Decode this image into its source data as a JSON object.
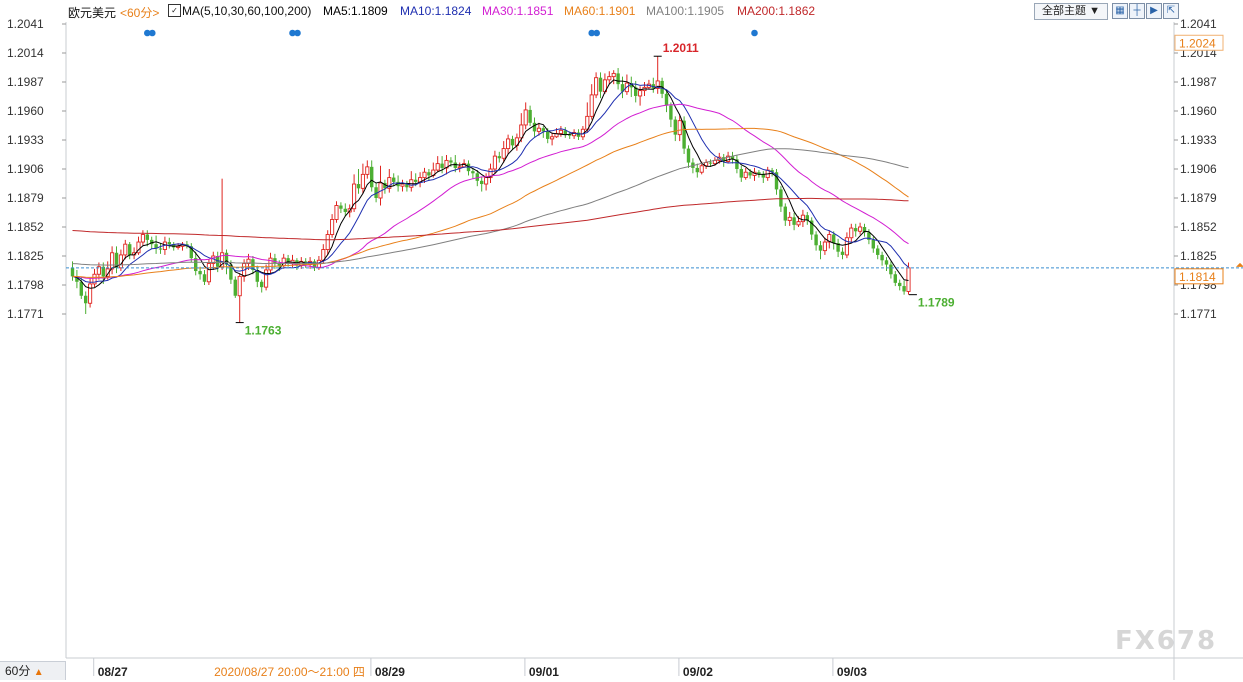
{
  "header": {
    "symbol": "欧元美元",
    "period_tag": "<60分>",
    "ma_title": "MA(5,10,30,60,100,200)",
    "ma_values": [
      {
        "text": "MA5:1.1809",
        "color": "#000000"
      },
      {
        "text": "MA10:1.1824",
        "color": "#1f2fb0"
      },
      {
        "text": "MA30:1.1851",
        "color": "#d21ed2"
      },
      {
        "text": "MA60:1.1901",
        "color": "#e8801a"
      },
      {
        "text": "MA100:1.1905",
        "color": "#808080"
      },
      {
        "text": "MA200:1.1862",
        "color": "#c0282a"
      }
    ],
    "theme_select": "全部主题",
    "tool_icons": [
      "grid-icon",
      "crosshair-icon",
      "play-icon",
      "export-icon"
    ]
  },
  "footer": {
    "period_button": "60分",
    "watermark": "FX678"
  },
  "chart_data": {
    "type": "candlestick",
    "title": "欧元美元",
    "interval": "60分",
    "y_ticks": [
      "1.2041",
      "1.2014",
      "1.1987",
      "1.1960",
      "1.1933",
      "1.1906",
      "1.1879",
      "1.1852",
      "1.1825",
      "1.1798",
      "1.1771"
    ],
    "ylim": [
      1.175,
      1.2041
    ],
    "x_labels": [
      {
        "label": "08/27",
        "bar": 8
      },
      {
        "label": "2020/08/27 20:00～21:00 四",
        "bar": 34,
        "highlight": true
      },
      {
        "label": "08/29",
        "bar": 71
      },
      {
        "label": "09/01",
        "bar": 106
      },
      {
        "label": "09/02",
        "bar": 141
      },
      {
        "label": "09/03",
        "bar": 176
      }
    ],
    "current_price": "1.1814",
    "last_price_value": 1.1814,
    "ma200_tag": "1.2024",
    "annotations": [
      {
        "text": "1.2011",
        "bar": 133,
        "price": 1.2011,
        "type": "high"
      },
      {
        "text": "1.1763",
        "bar": 38,
        "price": 1.1763,
        "type": "low"
      },
      {
        "text": "1.1789",
        "bar": 191,
        "price": 1.1789,
        "type": "low"
      }
    ],
    "event_dots": [
      17,
      50,
      118,
      155
    ],
    "candles": [
      [
        1.1814,
        1.1806,
        1.182,
        1.1802
      ],
      [
        1.1806,
        1.1801,
        1.1812,
        1.1795
      ],
      [
        1.1801,
        1.1788,
        1.1805,
        1.1785
      ],
      [
        1.1788,
        1.1781,
        1.1792,
        1.1771
      ],
      [
        1.1781,
        1.1799,
        1.1804,
        1.1777
      ],
      [
        1.1799,
        1.1808,
        1.1813,
        1.1796
      ],
      [
        1.1808,
        1.1815,
        1.1819,
        1.1803
      ],
      [
        1.1815,
        1.1806,
        1.1819,
        1.1799
      ],
      [
        1.1806,
        1.1813,
        1.182,
        1.1803
      ],
      [
        1.1813,
        1.1828,
        1.1834,
        1.1808
      ],
      [
        1.1828,
        1.1814,
        1.1834,
        1.1809
      ],
      [
        1.1814,
        1.1826,
        1.1831,
        1.1811
      ],
      [
        1.1826,
        1.1836,
        1.184,
        1.1822
      ],
      [
        1.1836,
        1.1826,
        1.1838,
        1.1822
      ],
      [
        1.1826,
        1.1828,
        1.1833,
        1.1822
      ],
      [
        1.1828,
        1.1838,
        1.1843,
        1.1826
      ],
      [
        1.1838,
        1.1845,
        1.1849,
        1.1835
      ],
      [
        1.1845,
        1.184,
        1.1849,
        1.1834
      ],
      [
        1.184,
        1.1836,
        1.1843,
        1.1832
      ],
      [
        1.1836,
        1.1832,
        1.1844,
        1.1827
      ],
      [
        1.1832,
        1.1831,
        1.1837,
        1.1827
      ],
      [
        1.1831,
        1.1838,
        1.1843,
        1.1826
      ],
      [
        1.1838,
        1.1836,
        1.1842,
        1.1832
      ],
      [
        1.1836,
        1.1833,
        1.1838,
        1.183
      ],
      [
        1.1833,
        1.1834,
        1.1837,
        1.1831
      ],
      [
        1.1834,
        1.1836,
        1.1838,
        1.183
      ],
      [
        1.1836,
        1.1834,
        1.1839,
        1.1832
      ],
      [
        1.1834,
        1.1823,
        1.1837,
        1.1819
      ],
      [
        1.1823,
        1.1811,
        1.1829,
        1.1807
      ],
      [
        1.1811,
        1.1808,
        1.1815,
        1.1803
      ],
      [
        1.1808,
        1.1801,
        1.1812,
        1.1798
      ],
      [
        1.1801,
        1.1818,
        1.1822,
        1.1798
      ],
      [
        1.1818,
        1.1825,
        1.1829,
        1.1812
      ],
      [
        1.1825,
        1.1815,
        1.1829,
        1.181
      ],
      [
        1.1815,
        1.1828,
        1.1897,
        1.1812
      ],
      [
        1.1828,
        1.1817,
        1.1831,
        1.1808
      ],
      [
        1.1817,
        1.1803,
        1.1821,
        1.1799
      ],
      [
        1.1803,
        1.1788,
        1.1806,
        1.1786
      ],
      [
        1.1788,
        1.1806,
        1.1809,
        1.1763
      ],
      [
        1.1806,
        1.1818,
        1.1822,
        1.1801
      ],
      [
        1.1818,
        1.1822,
        1.1827,
        1.1812
      ],
      [
        1.1822,
        1.1812,
        1.1825,
        1.1808
      ],
      [
        1.1812,
        1.1801,
        1.1816,
        1.1796
      ],
      [
        1.1801,
        1.1796,
        1.1803,
        1.1791
      ],
      [
        1.1796,
        1.1812,
        1.1817,
        1.1793
      ],
      [
        1.1812,
        1.1823,
        1.1828,
        1.1809
      ],
      [
        1.1823,
        1.1818,
        1.1827,
        1.1813
      ],
      [
        1.1818,
        1.1816,
        1.1821,
        1.1811
      ],
      [
        1.1816,
        1.1823,
        1.1827,
        1.1813
      ],
      [
        1.1823,
        1.1818,
        1.1826,
        1.1815
      ],
      [
        1.1818,
        1.1821,
        1.1826,
        1.1814
      ],
      [
        1.1821,
        1.1816,
        1.1823,
        1.1812
      ],
      [
        1.1816,
        1.182,
        1.1824,
        1.1813
      ],
      [
        1.182,
        1.1817,
        1.1823,
        1.1814
      ],
      [
        1.1817,
        1.182,
        1.1824,
        1.1813
      ],
      [
        1.182,
        1.1814,
        1.1822,
        1.1811
      ],
      [
        1.1814,
        1.1821,
        1.1825,
        1.1812
      ],
      [
        1.1821,
        1.1831,
        1.1836,
        1.1818
      ],
      [
        1.1831,
        1.1845,
        1.1849,
        1.1826
      ],
      [
        1.1845,
        1.1859,
        1.1864,
        1.1842
      ],
      [
        1.1859,
        1.1872,
        1.1876,
        1.1856
      ],
      [
        1.1872,
        1.1869,
        1.1875,
        1.1865
      ],
      [
        1.1869,
        1.1866,
        1.1874,
        1.1862
      ],
      [
        1.1866,
        1.1869,
        1.1873,
        1.1861
      ],
      [
        1.1869,
        1.1892,
        1.1901,
        1.1866
      ],
      [
        1.1892,
        1.1888,
        1.1906,
        1.1883
      ],
      [
        1.1888,
        1.1901,
        1.1911,
        1.1883
      ],
      [
        1.1901,
        1.1908,
        1.1914,
        1.1897
      ],
      [
        1.1908,
        1.1889,
        1.1914,
        1.1885
      ],
      [
        1.1889,
        1.1879,
        1.1893,
        1.1875
      ],
      [
        1.1879,
        1.1893,
        1.1909,
        1.1872
      ],
      [
        1.1893,
        1.1888,
        1.1896,
        1.1883
      ],
      [
        1.1888,
        1.1898,
        1.1906,
        1.1884
      ],
      [
        1.1898,
        1.1894,
        1.1902,
        1.189
      ],
      [
        1.1894,
        1.189,
        1.19,
        1.1885
      ],
      [
        1.189,
        1.1892,
        1.1896,
        1.1885
      ],
      [
        1.1892,
        1.1889,
        1.1895,
        1.1885
      ],
      [
        1.1889,
        1.1896,
        1.1904,
        1.1885
      ],
      [
        1.1896,
        1.1894,
        1.1902,
        1.189
      ],
      [
        1.1894,
        1.1898,
        1.1903,
        1.1889
      ],
      [
        1.1898,
        1.1903,
        1.1907,
        1.1893
      ],
      [
        1.1903,
        1.19,
        1.1906,
        1.1895
      ],
      [
        1.19,
        1.1905,
        1.1912,
        1.1898
      ],
      [
        1.1905,
        1.1911,
        1.1918,
        1.1903
      ],
      [
        1.1911,
        1.1907,
        1.1918,
        1.1902
      ],
      [
        1.1907,
        1.1914,
        1.1919,
        1.1901
      ],
      [
        1.1914,
        1.1912,
        1.1917,
        1.1908
      ],
      [
        1.1912,
        1.1907,
        1.1919,
        1.1903
      ],
      [
        1.1907,
        1.1908,
        1.1912,
        1.1903
      ],
      [
        1.1908,
        1.1911,
        1.1915,
        1.1907
      ],
      [
        1.1911,
        1.1904,
        1.1914,
        1.19
      ],
      [
        1.1904,
        1.1902,
        1.1907,
        1.1897
      ],
      [
        1.1902,
        1.1895,
        1.1905,
        1.189
      ],
      [
        1.1895,
        1.1892,
        1.1899,
        1.1885
      ],
      [
        1.1892,
        1.1898,
        1.1902,
        1.1886
      ],
      [
        1.1898,
        1.1906,
        1.1911,
        1.1893
      ],
      [
        1.1906,
        1.1918,
        1.1923,
        1.1902
      ],
      [
        1.1918,
        1.1916,
        1.1922,
        1.1912
      ],
      [
        1.1916,
        1.1925,
        1.1932,
        1.1912
      ],
      [
        1.1925,
        1.1934,
        1.1938,
        1.192
      ],
      [
        1.1934,
        1.1928,
        1.1937,
        1.1924
      ],
      [
        1.1928,
        1.1935,
        1.1939,
        1.1923
      ],
      [
        1.1935,
        1.1947,
        1.1958,
        1.1931
      ],
      [
        1.1947,
        1.1961,
        1.1968,
        1.1943
      ],
      [
        1.1961,
        1.1949,
        1.1965,
        1.1946
      ],
      [
        1.1949,
        1.1941,
        1.1954,
        1.1936
      ],
      [
        1.1941,
        1.1944,
        1.1949,
        1.1937
      ],
      [
        1.1944,
        1.1941,
        1.1946,
        1.1935
      ],
      [
        1.1941,
        1.1934,
        1.1944,
        1.193
      ],
      [
        1.1934,
        1.1936,
        1.194,
        1.1928
      ],
      [
        1.1936,
        1.1939,
        1.1944,
        1.1935
      ],
      [
        1.1939,
        1.1942,
        1.1946,
        1.1936
      ],
      [
        1.1942,
        1.1938,
        1.1945,
        1.1935
      ],
      [
        1.1938,
        1.1937,
        1.1941,
        1.1934
      ],
      [
        1.1937,
        1.194,
        1.1943,
        1.1934
      ],
      [
        1.194,
        1.1936,
        1.1943,
        1.1933
      ],
      [
        1.1936,
        1.1943,
        1.1946,
        1.1933
      ],
      [
        1.1943,
        1.1955,
        1.1968,
        1.194
      ],
      [
        1.1955,
        1.1975,
        1.1985,
        1.1952
      ],
      [
        1.1975,
        1.1991,
        1.1996,
        1.1972
      ],
      [
        1.1991,
        1.1978,
        1.1996,
        1.1972
      ],
      [
        1.1978,
        1.1989,
        1.1995,
        1.1976
      ],
      [
        1.1989,
        1.1992,
        1.1997,
        1.1985
      ],
      [
        1.1992,
        1.1995,
        1.1998,
        1.1985
      ],
      [
        1.1995,
        1.1985,
        1.2,
        1.198
      ],
      [
        1.1985,
        1.1978,
        1.1992,
        1.1972
      ],
      [
        1.1978,
        1.1986,
        1.1994,
        1.1975
      ],
      [
        1.1986,
        1.1982,
        1.1992,
        1.1973
      ],
      [
        1.1982,
        1.1974,
        1.1988,
        1.1968
      ],
      [
        1.1974,
        1.1979,
        1.1983,
        1.1965
      ],
      [
        1.1979,
        1.1982,
        1.1987,
        1.1974
      ],
      [
        1.1982,
        1.1985,
        1.1989,
        1.198
      ],
      [
        1.1985,
        1.1981,
        1.1991,
        1.1977
      ],
      [
        1.1981,
        1.1988,
        1.2011,
        1.1976
      ],
      [
        1.1988,
        1.1976,
        1.1991,
        1.1972
      ],
      [
        1.1976,
        1.1965,
        1.1979,
        1.1959
      ],
      [
        1.1965,
        1.1952,
        1.1968,
        1.1945
      ],
      [
        1.1952,
        1.1938,
        1.1955,
        1.1932
      ],
      [
        1.1938,
        1.1951,
        1.1956,
        1.1932
      ],
      [
        1.1951,
        1.1925,
        1.1955,
        1.192
      ],
      [
        1.1925,
        1.1912,
        1.1928,
        1.1907
      ],
      [
        1.1912,
        1.1907,
        1.1916,
        1.1902
      ],
      [
        1.1907,
        1.1903,
        1.1911,
        1.1898
      ],
      [
        1.1903,
        1.1909,
        1.1913,
        1.1901
      ],
      [
        1.1909,
        1.1912,
        1.1915,
        1.1906
      ],
      [
        1.1912,
        1.1911,
        1.1915,
        1.1908
      ],
      [
        1.1911,
        1.1914,
        1.1917,
        1.1909
      ],
      [
        1.1914,
        1.1917,
        1.1921,
        1.1911
      ],
      [
        1.1917,
        1.1913,
        1.192,
        1.1908
      ],
      [
        1.1913,
        1.1918,
        1.1922,
        1.1912
      ],
      [
        1.1918,
        1.1915,
        1.1922,
        1.1911
      ],
      [
        1.1915,
        1.1906,
        1.1919,
        1.1902
      ],
      [
        1.1906,
        1.1898,
        1.1909,
        1.1894
      ],
      [
        1.1898,
        1.1903,
        1.1907,
        1.1896
      ],
      [
        1.1903,
        1.19,
        1.1906,
        1.1897
      ],
      [
        1.19,
        1.1903,
        1.1907,
        1.1895
      ],
      [
        1.1903,
        1.1901,
        1.1905,
        1.1898
      ],
      [
        1.1901,
        1.1898,
        1.1904,
        1.1893
      ],
      [
        1.1898,
        1.1905,
        1.1908,
        1.1895
      ],
      [
        1.1905,
        1.1903,
        1.1907,
        1.1899
      ],
      [
        1.1903,
        1.1887,
        1.1906,
        1.1882
      ],
      [
        1.1887,
        1.1871,
        1.189,
        1.1866
      ],
      [
        1.1871,
        1.1858,
        1.1874,
        1.1853
      ],
      [
        1.1858,
        1.1861,
        1.1866,
        1.1853
      ],
      [
        1.1861,
        1.1854,
        1.1865,
        1.1849
      ],
      [
        1.1854,
        1.1857,
        1.1862,
        1.1852
      ],
      [
        1.1857,
        1.1863,
        1.1868,
        1.1852
      ],
      [
        1.1863,
        1.1858,
        1.1866,
        1.1854
      ],
      [
        1.1858,
        1.1845,
        1.1861,
        1.184
      ],
      [
        1.1845,
        1.1835,
        1.1848,
        1.183
      ],
      [
        1.1835,
        1.183,
        1.1839,
        1.1822
      ],
      [
        1.183,
        1.1838,
        1.1842,
        1.1826
      ],
      [
        1.1838,
        1.1845,
        1.1849,
        1.1832
      ],
      [
        1.1845,
        1.1837,
        1.1848,
        1.1831
      ],
      [
        1.1837,
        1.1829,
        1.1841,
        1.1824
      ],
      [
        1.1829,
        1.1826,
        1.1833,
        1.1822
      ],
      [
        1.1826,
        1.1842,
        1.1847,
        1.1823
      ],
      [
        1.1842,
        1.1851,
        1.1855,
        1.1838
      ],
      [
        1.1851,
        1.1848,
        1.1855,
        1.1843
      ],
      [
        1.1848,
        1.1852,
        1.1856,
        1.1845
      ],
      [
        1.1852,
        1.1847,
        1.1855,
        1.1843
      ],
      [
        1.1847,
        1.184,
        1.185,
        1.1836
      ],
      [
        1.184,
        1.1832,
        1.1843,
        1.1828
      ],
      [
        1.1832,
        1.1826,
        1.1835,
        1.1822
      ],
      [
        1.1826,
        1.1821,
        1.1829,
        1.1816
      ],
      [
        1.1821,
        1.1817,
        1.1824,
        1.1811
      ],
      [
        1.1817,
        1.1808,
        1.182,
        1.1804
      ],
      [
        1.1808,
        1.18,
        1.1811,
        1.1797
      ],
      [
        1.18,
        1.1797,
        1.1803,
        1.1793
      ],
      [
        1.1797,
        1.1792,
        1.1802,
        1.1789
      ],
      [
        1.1792,
        1.1814,
        1.1819,
        1.1789
      ]
    ],
    "ma_series": [
      {
        "name": "MA5",
        "period": 5,
        "color": "#000000"
      },
      {
        "name": "MA10",
        "period": 10,
        "color": "#1f2fb0"
      },
      {
        "name": "MA30",
        "period": 30,
        "color": "#d21ed2"
      },
      {
        "name": "MA60",
        "period": 60,
        "color": "#e8801a"
      },
      {
        "name": "MA100",
        "period": 100,
        "color": "#808080"
      },
      {
        "name": "MA200",
        "period": 200,
        "color": "#c0282a"
      }
    ]
  }
}
